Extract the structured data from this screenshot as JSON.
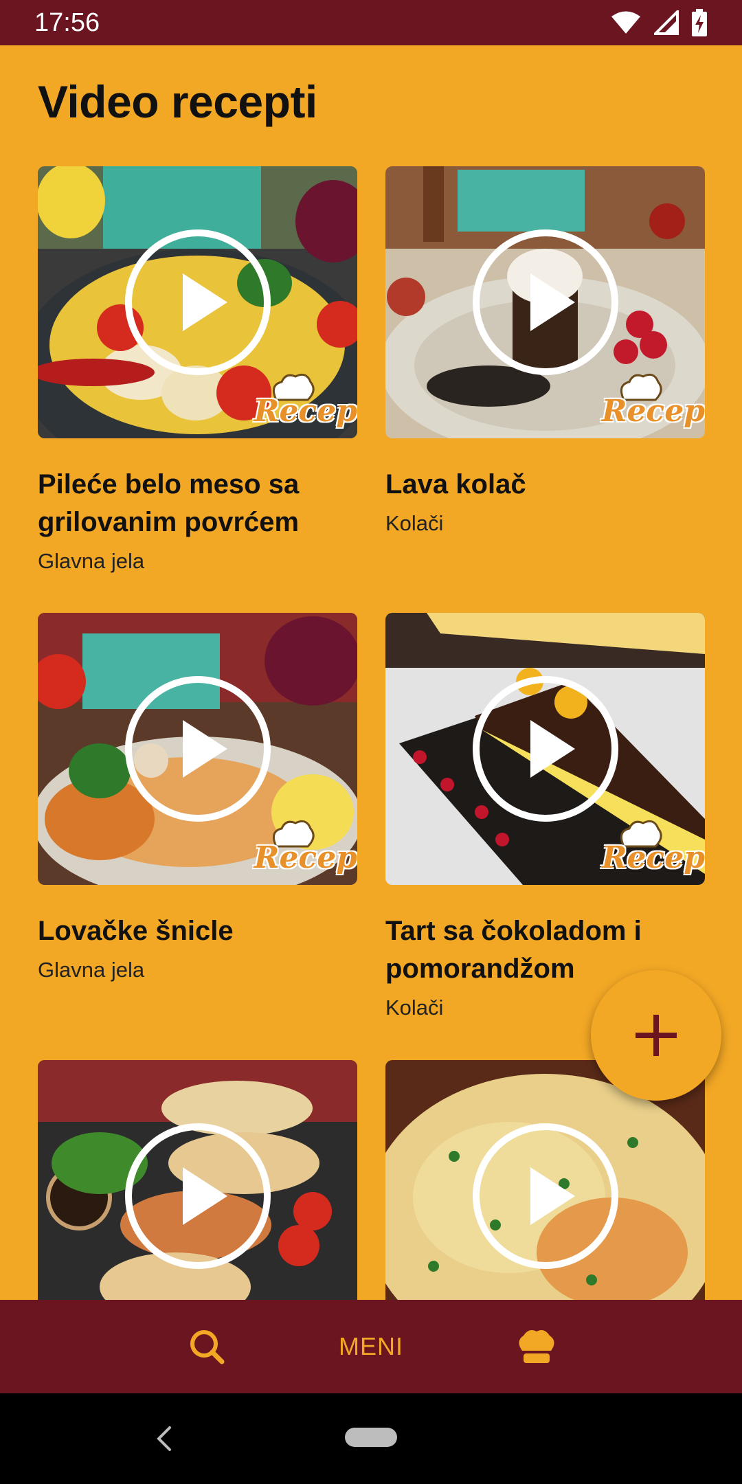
{
  "status_bar": {
    "time": "17:56"
  },
  "page_title": "Video recepti",
  "watermark_text": "Recep",
  "cards": [
    {
      "title": "Pileće belo meso sa grilovanim povrćem",
      "category": "Glavna jela"
    },
    {
      "title": "Lava kolač",
      "category": "Kolači"
    },
    {
      "title": "Lovačke šnicle",
      "category": "Glavna jela"
    },
    {
      "title": "Tart sa čokoladom i pomorandžom",
      "category": "Kolači"
    },
    {
      "title": "",
      "category": ""
    },
    {
      "title": "",
      "category": ""
    }
  ],
  "bottom_nav": {
    "menu_label": "MENI"
  },
  "colors": {
    "background": "#F2A725",
    "bar": "#6B1520",
    "accent": "#F2A725",
    "fab_icon": "#6B1520"
  }
}
